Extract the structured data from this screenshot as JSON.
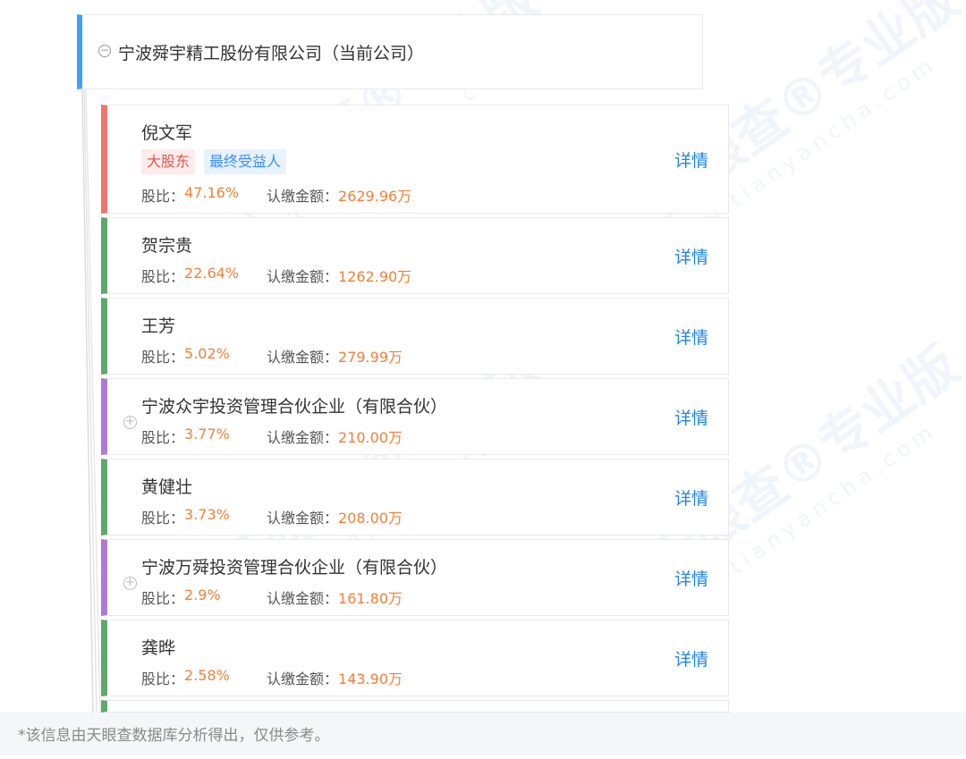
{
  "root": {
    "title": "宁波舜宇精工股份有限公司（当前公司）",
    "toggle_symbol": "−",
    "accent_color": "#3ea0ff"
  },
  "labels": {
    "share": "股比：",
    "amount": "认缴金额：",
    "detail": "详情"
  },
  "shareholders": [
    {
      "name": "倪文军",
      "tags": [
        "大股东",
        "最终受益人"
      ],
      "share": "47.16%",
      "amount": "2629.96万",
      "color": "#f0756a",
      "expandable": false
    },
    {
      "name": "贺宗贵",
      "tags": [],
      "share": "22.64%",
      "amount": "1262.90万",
      "color": "#5fa86b",
      "expandable": false
    },
    {
      "name": "王芳",
      "tags": [],
      "share": "5.02%",
      "amount": "279.99万",
      "color": "#5fa86b",
      "expandable": false
    },
    {
      "name": "宁波众宇投资管理合伙企业（有限合伙）",
      "tags": [],
      "share": "3.77%",
      "amount": "210.00万",
      "color": "#b07ad6",
      "expandable": true
    },
    {
      "name": "黄健壮",
      "tags": [],
      "share": "3.73%",
      "amount": "208.00万",
      "color": "#5fa86b",
      "expandable": false
    },
    {
      "name": "宁波万舜投资管理合伙企业（有限合伙）",
      "tags": [],
      "share": "2.9%",
      "amount": "161.80万",
      "color": "#b07ad6",
      "expandable": true
    },
    {
      "name": "龚晔",
      "tags": [],
      "share": "2.58%",
      "amount": "143.90万",
      "color": "#5fa86b",
      "expandable": false
    }
  ],
  "footer": {
    "note": "*该信息由天眼查数据库分析得出，仅供参考。"
  },
  "watermark": {
    "brand": "天眼查®专业版",
    "domain": "pro.tianyancha.com"
  }
}
